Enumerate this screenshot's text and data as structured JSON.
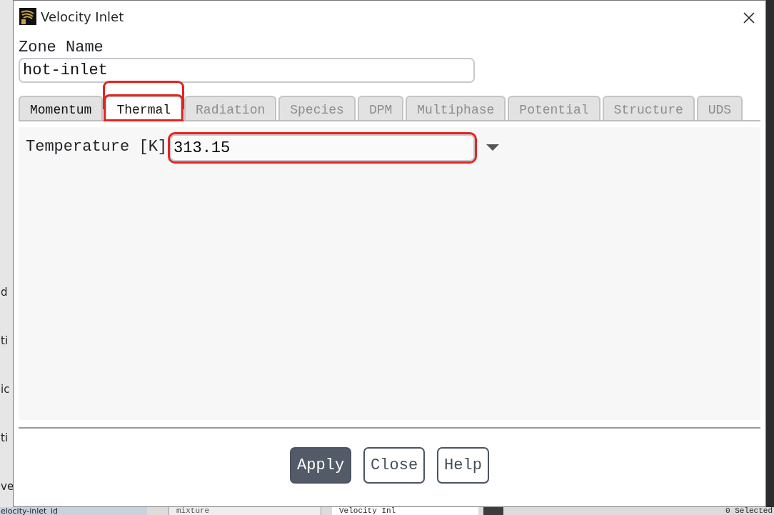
{
  "window": {
    "title": "Velocity Inlet"
  },
  "zone_name": {
    "label": "Zone Name",
    "value": "hot-inlet"
  },
  "tabs": [
    {
      "label": "Momentum",
      "selected": false,
      "disabled": false,
      "highlighted": false
    },
    {
      "label": "Thermal",
      "selected": true,
      "disabled": false,
      "highlighted": true
    },
    {
      "label": "Radiation",
      "selected": false,
      "disabled": true,
      "highlighted": false
    },
    {
      "label": "Species",
      "selected": false,
      "disabled": true,
      "highlighted": false
    },
    {
      "label": "DPM",
      "selected": false,
      "disabled": true,
      "highlighted": false
    },
    {
      "label": "Multiphase",
      "selected": false,
      "disabled": true,
      "highlighted": false
    },
    {
      "label": "Potential",
      "selected": false,
      "disabled": true,
      "highlighted": false
    },
    {
      "label": "Structure",
      "selected": false,
      "disabled": true,
      "highlighted": false
    },
    {
      "label": "UDS",
      "selected": false,
      "disabled": true,
      "highlighted": false
    }
  ],
  "temperature": {
    "label": "Temperature [K]",
    "value": "313.15",
    "highlighted": true
  },
  "buttons": [
    {
      "label": "Apply",
      "default": true
    },
    {
      "label": "Close",
      "default": false
    },
    {
      "label": "Help",
      "default": false
    }
  ],
  "background": {
    "left_fragments": [
      "d",
      "ti",
      "ic",
      "ti",
      "ve"
    ],
    "bottom_row": [
      "elocity-inlet_id",
      "mixture",
      "Velocity Inl",
      "0 Selected"
    ]
  }
}
